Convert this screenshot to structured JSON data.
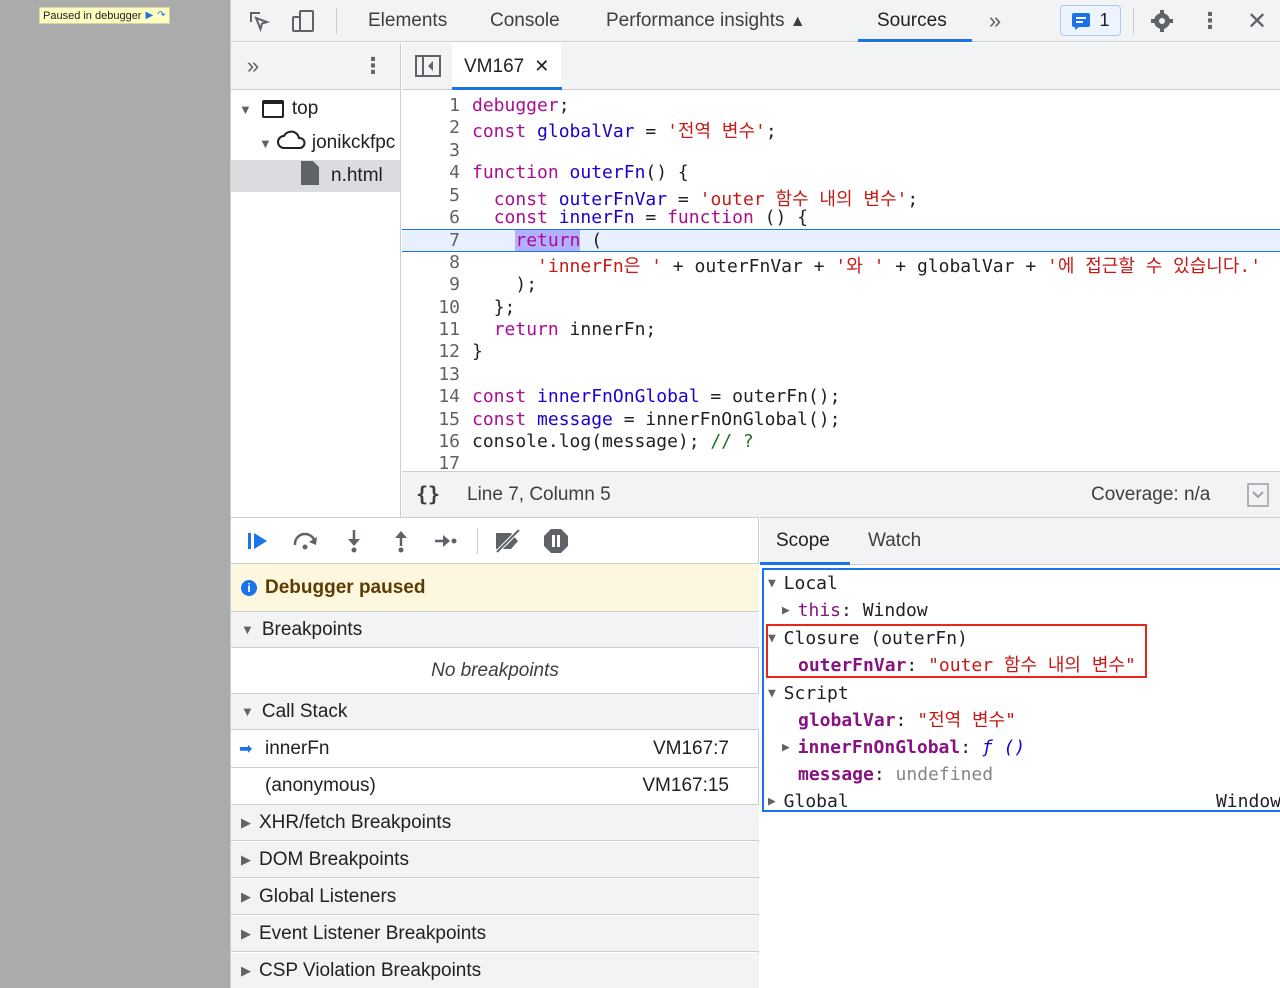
{
  "page": {
    "paused_badge": "Paused in debugger"
  },
  "toolbar": {
    "tabs": [
      "Elements",
      "Console",
      "Performance insights",
      "Sources"
    ],
    "issues_count": "1"
  },
  "navigator": {
    "top": "top",
    "domain": "jonikckfpc",
    "file": "n.html"
  },
  "editor": {
    "tab_title": "VM167",
    "status_position": "Line 7, Column 5",
    "status_coverage": "Coverage: n/a",
    "line_numbers": [
      "1",
      "2",
      "3",
      "4",
      "5",
      "6",
      "7",
      "8",
      "9",
      "10",
      "11",
      "12",
      "13",
      "14",
      "15",
      "16",
      "17"
    ],
    "code": {
      "l1_kw": "debugger",
      "l1_rest": ";",
      "l2_kw": "const",
      "l2_def": "globalVar",
      "l2_op": " = ",
      "l2_str": "'전역 변수'",
      "l2_end": ";",
      "l4_kw": "function",
      "l4_def": "outerFn",
      "l4_rest": "() {",
      "l5_kw": "const",
      "l5_def": "outerFnVar",
      "l5_op": " = ",
      "l5_str": "'outer 함수 내의 변수'",
      "l5_end": ";",
      "l6_kw": "const",
      "l6_def": "innerFn",
      "l6_op": " = ",
      "l6_kw2": "function",
      "l6_rest": " () {",
      "l7_kw": "return",
      "l7_rest": " (",
      "l8_str1": "'innerFn은 '",
      "l8_op1": " + outerFnVar + ",
      "l8_str2": "'와 '",
      "l8_op2": " + globalVar + ",
      "l8_str3": "'에 접근할 수 있습니다.'",
      "l9": ");",
      "l10": "};",
      "l11_kw": "return",
      "l11_rest": " innerFn;",
      "l12": "}",
      "l14_kw": "const",
      "l14_def": "innerFnOnGlobal",
      "l14_rest": " = outerFn();",
      "l15_kw": "const",
      "l15_def": "message",
      "l15_rest": " = innerFnOnGlobal();",
      "l16_code": "console.log(message); ",
      "l16_cm": "// ?"
    }
  },
  "debugger": {
    "paused_message": "Debugger paused",
    "breakpoints_title": "Breakpoints",
    "no_breakpoints": "No breakpoints",
    "call_stack_title": "Call Stack",
    "call_stack": [
      {
        "fn": "innerFn",
        "loc": "VM167:7"
      },
      {
        "fn": "(anonymous)",
        "loc": "VM167:15"
      }
    ],
    "sections": [
      "XHR/fetch Breakpoints",
      "DOM Breakpoints",
      "Global Listeners",
      "Event Listener Breakpoints",
      "CSP Violation Breakpoints"
    ]
  },
  "scope": {
    "tabs": [
      "Scope",
      "Watch"
    ],
    "local_title": "Local",
    "this_key": "this",
    "this_val": "Window",
    "closure_title": "Closure (outerFn)",
    "outerFnVar_key": "outerFnVar",
    "outerFnVar_val": "\"outer 함수 내의 변수\"",
    "script_title": "Script",
    "globalVar_key": "globalVar",
    "globalVar_val": "\"전역 변수\"",
    "innerFnOnGlobal_key": "innerFnOnGlobal",
    "innerFnOnGlobal_val": "ƒ ()",
    "message_key": "message",
    "message_val": "undefined",
    "global_title": "Global",
    "global_val": "Window"
  }
}
